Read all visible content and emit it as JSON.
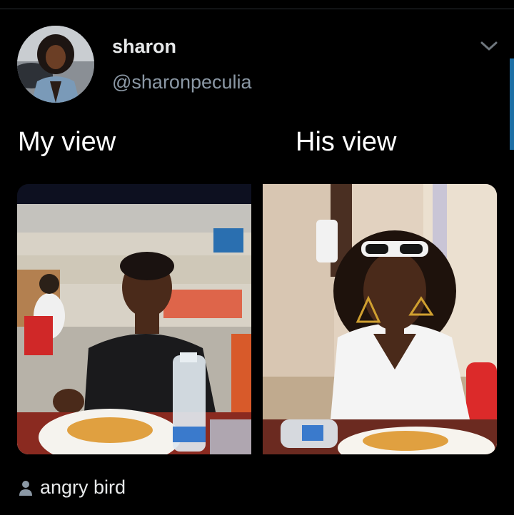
{
  "tweet": {
    "author": {
      "display_name": "sharon",
      "handle": "@sharonpeculia",
      "avatar_icon": "avatar-photo"
    },
    "captions": {
      "left": "My view",
      "right": "His view"
    },
    "media": [
      {
        "name": "my-view-photo",
        "description_icon": "restaurant-man-eating-photo"
      },
      {
        "name": "his-view-photo",
        "description_icon": "restaurant-woman-sunglasses-photo"
      }
    ],
    "tagged_user": "angry bird",
    "menu_icon": "chevron-down-icon"
  },
  "colors": {
    "background": "#000000",
    "text_primary": "#e7e9ea",
    "text_secondary": "#8b98a5",
    "scroll_accent": "#1d6fa5"
  }
}
